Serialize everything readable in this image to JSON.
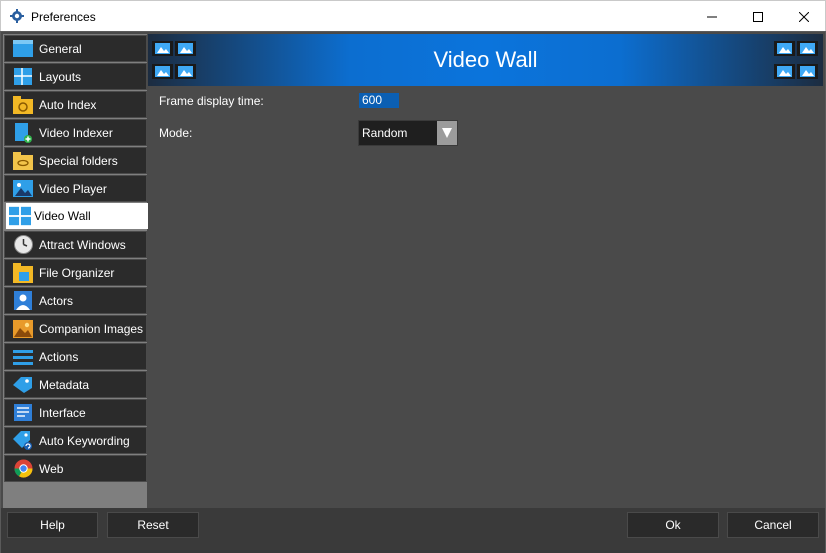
{
  "window": {
    "title": "Preferences",
    "app_icon": "gear-icon",
    "controls": {
      "minimize": "minimize-icon",
      "maximize": "maximize-icon",
      "close": "close-icon"
    }
  },
  "sidebar": {
    "items": [
      {
        "label": "General",
        "icon": "general-window-icon",
        "active": false
      },
      {
        "label": "Layouts",
        "icon": "layouts-grid-icon",
        "active": false
      },
      {
        "label": "Auto Index",
        "icon": "auto-index-icon",
        "active": false
      },
      {
        "label": "Video Indexer",
        "icon": "video-indexer-icon",
        "active": false
      },
      {
        "label": "Special folders",
        "icon": "special-folder-icon",
        "active": false
      },
      {
        "label": "Video Player",
        "icon": "video-player-icon",
        "active": false
      },
      {
        "label": "Video Wall",
        "icon": "video-wall-icon",
        "active": true
      },
      {
        "label": "Attract Windows",
        "icon": "clock-icon",
        "active": false
      },
      {
        "label": "File Organizer",
        "icon": "file-organizer-icon",
        "active": false
      },
      {
        "label": "Actors",
        "icon": "actor-icon",
        "active": false
      },
      {
        "label": "Companion Images",
        "icon": "companion-images-icon",
        "active": false
      },
      {
        "label": "Actions",
        "icon": "actions-icon",
        "active": false
      },
      {
        "label": "Metadata",
        "icon": "tag-icon",
        "active": false
      },
      {
        "label": "Interface",
        "icon": "interface-icon",
        "active": false
      },
      {
        "label": "Auto Keywording",
        "icon": "auto-keywording-icon",
        "active": false
      },
      {
        "label": "Web",
        "icon": "chrome-icon",
        "active": false
      }
    ]
  },
  "header": {
    "title": "Video Wall",
    "icon": "film-strip-icon"
  },
  "form": {
    "frame_display_time": {
      "label": "Frame display time:",
      "value": "600"
    },
    "mode": {
      "label": "Mode:",
      "value": "Random"
    }
  },
  "buttons": {
    "help": "Help",
    "reset": "Reset",
    "ok": "Ok",
    "cancel": "Cancel"
  },
  "colors": {
    "accent": "#0b74dc",
    "panel": "#4a4a4a",
    "nav_item": "#2b2b2b"
  }
}
